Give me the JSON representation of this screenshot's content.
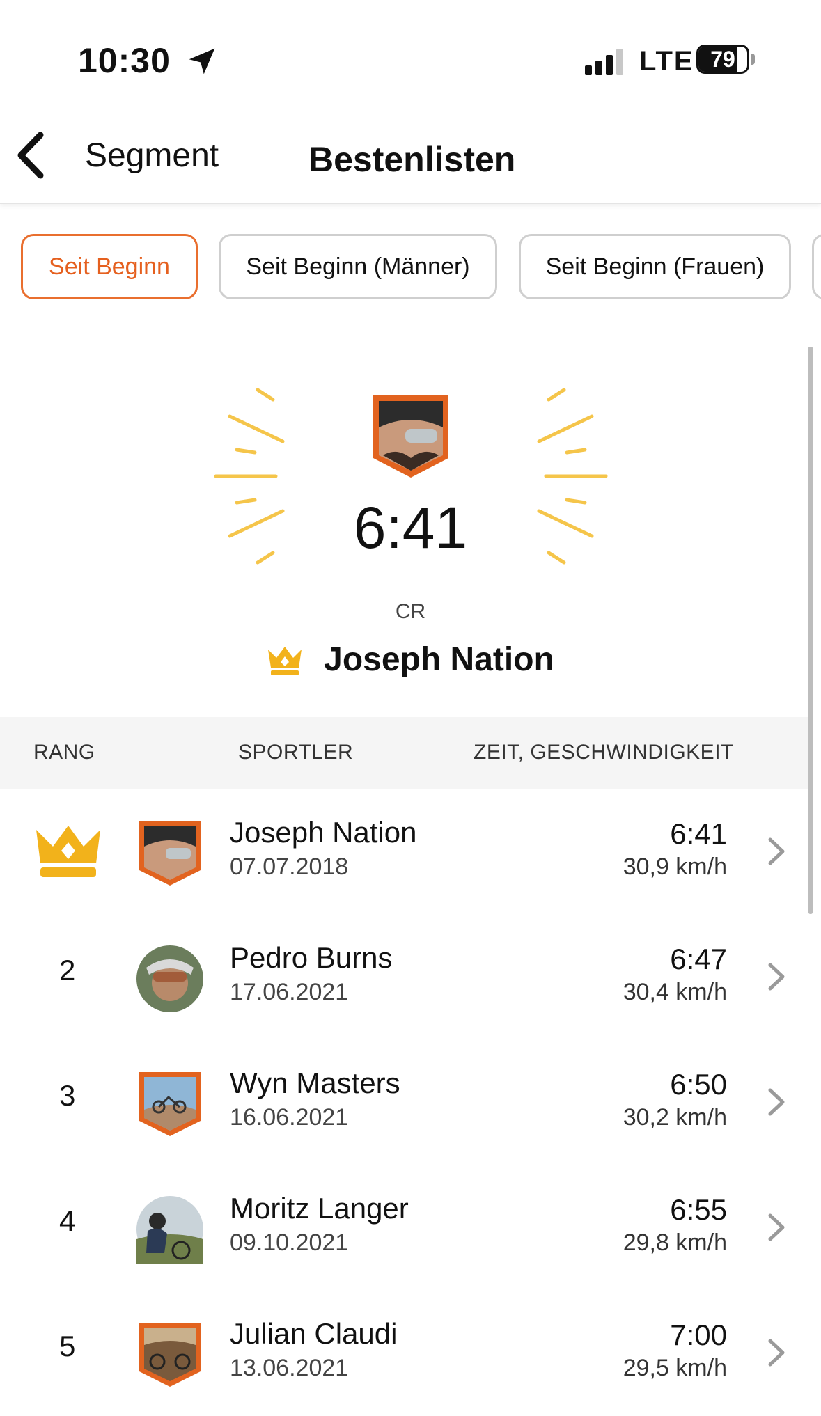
{
  "status_bar": {
    "time": "10:30",
    "network": "LTE",
    "battery": "79",
    "battery_level": 0.79
  },
  "nav": {
    "back_label": "Segment",
    "title": "Bestenlisten"
  },
  "filters": [
    {
      "label": "Seit Beginn",
      "active": true
    },
    {
      "label": "Seit Beginn (Männer)",
      "active": false
    },
    {
      "label": "Seit Beginn (Frauen)",
      "active": false
    }
  ],
  "hero": {
    "time": "6:41",
    "label": "CR",
    "name": "Joseph Nation"
  },
  "table": {
    "headers": {
      "rank": "RANG",
      "athlete": "SPORTLER",
      "time_speed": "ZEIT, GESCHWINDIGKEIT"
    },
    "rows": [
      {
        "rank": "",
        "crown": true,
        "name": "Joseph Nation",
        "date": "07.07.2018",
        "time": "6:41",
        "speed": "30,9 km/h",
        "avatar": "shield"
      },
      {
        "rank": "2",
        "crown": false,
        "name": "Pedro Burns",
        "date": "17.06.2021",
        "time": "6:47",
        "speed": "30,4 km/h",
        "avatar": "circle"
      },
      {
        "rank": "3",
        "crown": false,
        "name": "Wyn Masters",
        "date": "16.06.2021",
        "time": "6:50",
        "speed": "30,2 km/h",
        "avatar": "shield"
      },
      {
        "rank": "4",
        "crown": false,
        "name": "Moritz Langer",
        "date": "09.10.2021",
        "time": "6:55",
        "speed": "29,8 km/h",
        "avatar": "circle"
      },
      {
        "rank": "5",
        "crown": false,
        "name": "Julian Claudi",
        "date": "13.06.2021",
        "time": "7:00",
        "speed": "29,5 km/h",
        "avatar": "shield"
      }
    ]
  },
  "colors": {
    "accent": "#e96f2f",
    "crown": "#f2b21b",
    "rays": "#f5c54a"
  },
  "icons": [
    "location-arrow-icon",
    "signal-icon",
    "battery-icon",
    "back-chevron-icon",
    "crown-icon",
    "chevron-right-icon"
  ]
}
